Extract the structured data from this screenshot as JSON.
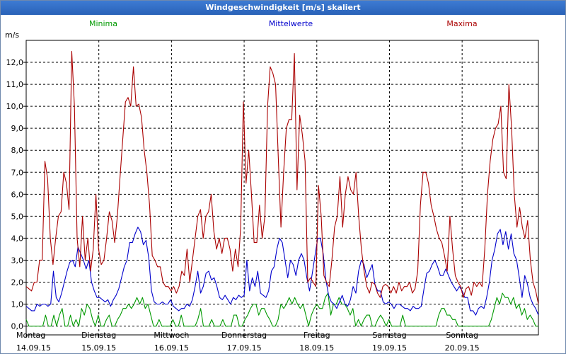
{
  "window": {
    "title": "Windgeschwindigkeit [m/s] skaliert"
  },
  "chart_data": {
    "type": "line",
    "title": "Windgeschwindigkeit [m/s] skaliert",
    "ylabel": "m/s",
    "ylim": [
      -0.4,
      13.0
    ],
    "yticks": [
      {
        "value": 0,
        "label": "0,0"
      },
      {
        "value": 1,
        "label": "1,0"
      },
      {
        "value": 2,
        "label": "2,0"
      },
      {
        "value": 3,
        "label": "3,0"
      },
      {
        "value": 4,
        "label": "4,0"
      },
      {
        "value": 5,
        "label": "5,0"
      },
      {
        "value": 6,
        "label": "6,0"
      },
      {
        "value": 7,
        "label": "7,0"
      },
      {
        "value": 8,
        "label": "8,0"
      },
      {
        "value": 9,
        "label": "9,0"
      },
      {
        "value": 10,
        "label": "10,0"
      },
      {
        "value": 11,
        "label": "11,0"
      },
      {
        "value": 12,
        "label": "12,0"
      }
    ],
    "xlim": [
      0,
      7.05
    ],
    "days": [
      {
        "day": "Montag",
        "date": "14.09.15"
      },
      {
        "day": "Dienstag",
        "date": "15.09.15"
      },
      {
        "day": "Mittwoch",
        "date": "16.09.15"
      },
      {
        "day": "Donnerstag",
        "date": "17.09.15"
      },
      {
        "day": "Freitag",
        "date": "18.09.15"
      },
      {
        "day": "Samstag",
        "date": "19.09.15"
      },
      {
        "day": "Sonntag",
        "date": "20.09.15"
      }
    ],
    "grid": true,
    "legend_position": "top",
    "series": [
      {
        "name": "Minima",
        "color": "#009900",
        "values": [
          0.3,
          0,
          0,
          0,
          0,
          0,
          0,
          0.5,
          0,
          0,
          0.5,
          0,
          0.5,
          0.8,
          0,
          0,
          0.5,
          0,
          0.3,
          0,
          0.8,
          0.5,
          1,
          0.8,
          0.3,
          0,
          0.5,
          0,
          0,
          0.3,
          0.5,
          0,
          0,
          0.3,
          0.5,
          0.8,
          0.8,
          1,
          0.8,
          1,
          1.3,
          1,
          1.3,
          0.8,
          1,
          0.5,
          0,
          0,
          0.3,
          0,
          0,
          0,
          0,
          0.3,
          0,
          0,
          0.5,
          0,
          0,
          0,
          0,
          0,
          0.3,
          0.8,
          0,
          0,
          0,
          0.3,
          0,
          0,
          0,
          0.3,
          0,
          0,
          0,
          0.5,
          0.5,
          0,
          0,
          0.3,
          0.5,
          0.8,
          1,
          1,
          0.5,
          0.8,
          0.8,
          0.5,
          0.3,
          0,
          0,
          0.3,
          1,
          0.8,
          1,
          1.3,
          1,
          1.3,
          1,
          0.8,
          1,
          0.5,
          0,
          0.5,
          0.8,
          1,
          0.8,
          0.8,
          1.3,
          1.5,
          0.5,
          1,
          1,
          1.3,
          1,
          1,
          0.8,
          0.5,
          0.8,
          0,
          0.3,
          0,
          0.3,
          0.5,
          0.5,
          0,
          0,
          0.3,
          0.5,
          0.3,
          0,
          0.3,
          0,
          0,
          0,
          0,
          0.5,
          0,
          0,
          0,
          0,
          0,
          0,
          0,
          0,
          0,
          0,
          0,
          0,
          0.5,
          0.8,
          0.8,
          0.5,
          0.5,
          0.3,
          0.3,
          0,
          0,
          0,
          0,
          0,
          0,
          0,
          0,
          0,
          0,
          0,
          0,
          0.3,
          0.8,
          1.3,
          1,
          1.5,
          1.3,
          1.3,
          1,
          1.3,
          0.8,
          1,
          0.5,
          0.8,
          0.3,
          0.5,
          0.3,
          0,
          0
        ]
      },
      {
        "name": "Mittelwerte",
        "color": "#0000cc",
        "values": [
          0.9,
          0.8,
          0.7,
          0.7,
          1,
          0.9,
          1,
          1,
          0.9,
          1,
          2.5,
          1.3,
          1.1,
          1.5,
          2,
          2.5,
          2.9,
          3,
          2.7,
          3.6,
          3.3,
          3,
          2.6,
          3,
          2,
          1.6,
          1.3,
          1.3,
          1.2,
          1.1,
          1.2,
          0.9,
          1.2,
          1.4,
          1.7,
          2.2,
          2.7,
          3,
          3.8,
          3.8,
          4.2,
          4.5,
          4.3,
          3.7,
          3.9,
          3.1,
          1.6,
          1.1,
          1,
          1,
          1.1,
          1,
          1,
          1.2,
          0.9,
          0.8,
          0.7,
          0.8,
          0.8,
          1,
          0.9,
          1.2,
          1.8,
          2.5,
          1.5,
          1.8,
          2.4,
          2.5,
          2.1,
          2.2,
          1.8,
          1.3,
          1.2,
          1.4,
          1.2,
          1,
          1.3,
          1.2,
          1.4,
          1.3,
          1.4,
          3,
          1.6,
          2.2,
          1.8,
          2.5,
          1.5,
          1.4,
          1.3,
          1.6,
          2.5,
          2.7,
          3.5,
          4,
          3.8,
          3,
          2.2,
          3,
          2.8,
          2.3,
          3,
          3.3,
          3,
          2.2,
          1.6,
          2.4,
          3.2,
          4,
          4,
          3.3,
          2.1,
          1.4,
          1.1,
          1,
          0.8,
          1.1,
          1.4,
          1,
          0.9,
          1.2,
          1.8,
          1.5,
          2.5,
          3,
          2.8,
          2.2,
          2.5,
          2.8,
          1.9,
          1.6,
          1.6,
          1.1,
          1,
          1.1,
          1,
          0.8,
          1,
          1,
          0.9,
          0.8,
          0.8,
          0.7,
          0.9,
          0.8,
          0.8,
          0.9,
          1.7,
          2.4,
          2.5,
          2.8,
          3,
          2.7,
          2.3,
          2.3,
          2.6,
          2.3,
          2,
          1.8,
          1.6,
          1.8,
          1.6,
          1.3,
          1.3,
          0.7,
          0.7,
          0.5,
          0.8,
          0.9,
          0.8,
          1.3,
          2,
          3,
          3.5,
          4.2,
          4.4,
          3.7,
          4.3,
          3.5,
          4.2,
          3.3,
          3,
          2.2,
          1.3,
          2.3,
          1.9,
          1.3,
          1,
          0.8,
          0.5
        ]
      },
      {
        "name": "Maxima",
        "color": "#aa0000",
        "values": [
          1.8,
          1.7,
          1.6,
          2,
          2,
          3,
          3,
          7.5,
          6.7,
          4,
          2.8,
          4,
          5,
          5.2,
          7,
          6.5,
          5.3,
          12.5,
          10,
          4,
          2.7,
          5,
          3,
          4,
          2.5,
          3.5,
          6,
          3.5,
          2.8,
          3,
          4,
          5.2,
          4.8,
          3.8,
          5,
          6.8,
          8.5,
          10.2,
          10.4,
          10,
          11.8,
          10,
          10.1,
          9.5,
          8,
          7,
          5.5,
          3.2,
          3,
          2.7,
          2.7,
          2,
          1.8,
          1.8,
          1.6,
          1.8,
          1.5,
          1.8,
          2.5,
          2.3,
          3.5,
          2,
          3,
          4,
          5,
          5.3,
          4,
          5,
          5.2,
          6,
          4.3,
          3.5,
          4,
          3.3,
          4,
          4,
          3.5,
          2.5,
          3.5,
          2.7,
          4.5,
          10.2,
          6.5,
          8,
          6,
          3.8,
          3.8,
          5.5,
          4,
          5,
          10,
          11.8,
          11.5,
          11,
          7.7,
          4.5,
          7,
          9,
          9.4,
          9.4,
          12.4,
          6.2,
          9.6,
          8.7,
          7.5,
          2,
          2.2,
          2,
          1.8,
          6.4,
          5,
          2.3,
          2,
          1.8,
          3,
          4.5,
          5,
          6.8,
          4.5,
          6,
          6.8,
          6.2,
          6,
          7,
          5,
          3.5,
          2.5,
          1.8,
          1.5,
          2,
          1.9,
          1.5,
          1.3,
          1.8,
          1.9,
          1.8,
          1.5,
          1.8,
          1.5,
          2,
          1.6,
          1.8,
          1.8,
          2,
          1.5,
          1.7,
          2.5,
          5.5,
          7,
          7,
          6.5,
          5.5,
          5,
          4.4,
          4,
          3.8,
          3.2,
          2.5,
          5,
          3.5,
          2.3,
          2,
          1.8,
          1.3,
          1.7,
          1.8,
          1.4,
          2,
          1.8,
          2,
          1.8,
          3.5,
          6,
          7.5,
          8.5,
          9,
          9.2,
          10,
          7,
          6.7,
          11,
          9,
          6,
          4.5,
          5.4,
          4.5,
          4,
          4.8,
          3,
          2,
          1.6,
          1
        ]
      }
    ]
  }
}
